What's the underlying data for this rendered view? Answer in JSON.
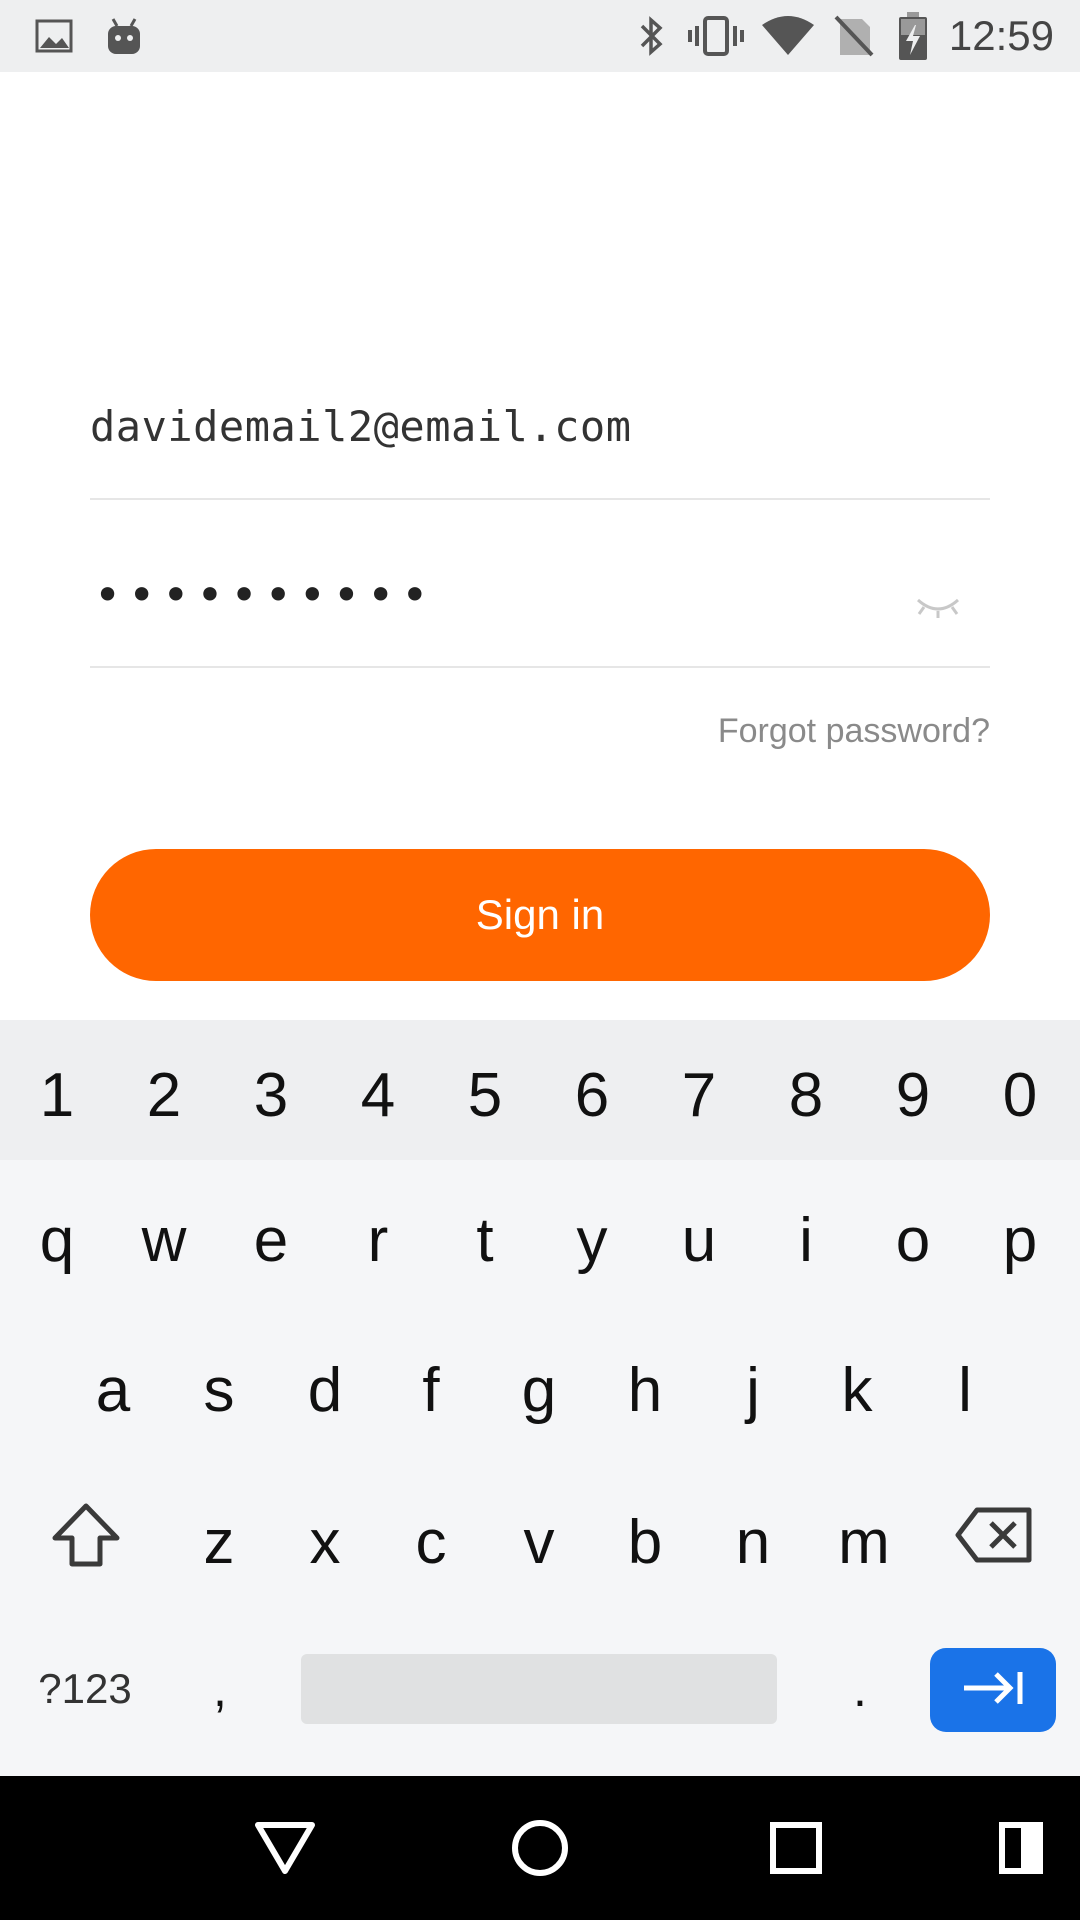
{
  "status_bar": {
    "time": "12:59",
    "icons": [
      "image-icon",
      "android-icon",
      "bluetooth-icon",
      "vibrate-icon",
      "wifi-icon",
      "no-sim-icon",
      "battery-charging-icon"
    ]
  },
  "form": {
    "email_value": "davidemail2@email.com",
    "password_value": "••••••••••",
    "forgot_label": "Forgot password?",
    "signin_label": "Sign in"
  },
  "keyboard": {
    "number_row": [
      "1",
      "2",
      "3",
      "4",
      "5",
      "6",
      "7",
      "8",
      "9",
      "0"
    ],
    "row1": [
      "q",
      "w",
      "e",
      "r",
      "t",
      "y",
      "u",
      "i",
      "o",
      "p"
    ],
    "row2": [
      "a",
      "s",
      "d",
      "f",
      "g",
      "h",
      "j",
      "k",
      "l"
    ],
    "row3": [
      "z",
      "x",
      "c",
      "v",
      "b",
      "n",
      "m"
    ],
    "symbols_label": "?123",
    "comma_label": ",",
    "period_label": "."
  },
  "colors": {
    "accent": "#ff6600",
    "enter_key": "#1a73e8"
  }
}
